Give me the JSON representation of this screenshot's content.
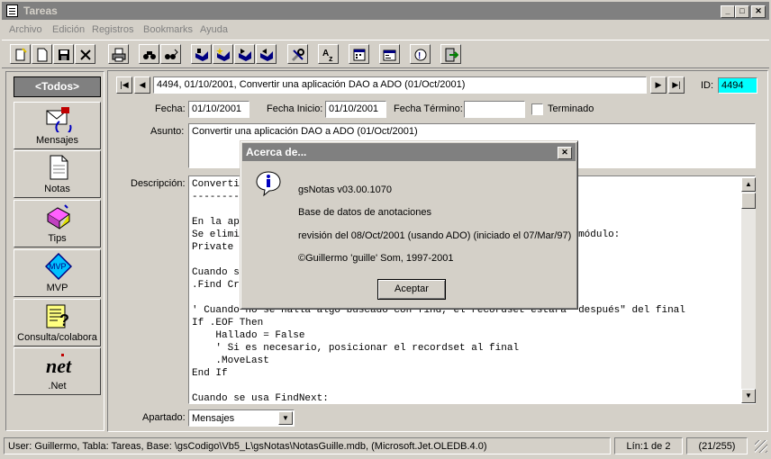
{
  "window": {
    "title": "Tareas"
  },
  "menu": [
    "Archivo",
    "Edición",
    "Registros",
    "Bookmarks",
    "Ayuda"
  ],
  "toolbar_icons": [
    "new-icon",
    "new-doc-icon",
    "save-icon",
    "delete-icon",
    "print-icon",
    "find-icon",
    "find-next-icon",
    "bookmark-icon",
    "bookmark-add-icon",
    "bookmark-next-icon",
    "bookmark-prev-icon",
    "tools-icon",
    "sort-az-icon",
    "calendar-icon",
    "properties-icon",
    "help-icon",
    "exit-icon"
  ],
  "sidebar": {
    "all_label": "<Todos>",
    "items": [
      {
        "label": "Mensajes",
        "icon": "mail-icon"
      },
      {
        "label": "Notas",
        "icon": "note-icon"
      },
      {
        "label": "Tips",
        "icon": "tips-icon"
      },
      {
        "label": "MVP",
        "icon": "mvp-icon"
      },
      {
        "label": "Consulta/colabora",
        "icon": "query-icon"
      },
      {
        "label": ".Net",
        "icon": "dotnet-icon"
      }
    ]
  },
  "record": {
    "selector": "4494, 01/10/2001, Convertir una aplicación DAO a ADO (01/Oct/2001)",
    "id_label": "ID:",
    "id_value": "4494",
    "fecha_label": "Fecha:",
    "fecha": "01/10/2001",
    "fecha_inicio_label": "Fecha Inicio:",
    "fecha_inicio": "01/10/2001",
    "fecha_termino_label": "Fecha Término:",
    "fecha_termino": "",
    "terminado_label": "Terminado",
    "asunto_label": "Asunto:",
    "asunto": "Convertir una aplicación DAO a ADO (01/Oct/2001)",
    "descripcion_label": "Descripción:",
    "descripcion": "Convertir\n---------\n\nEn la ap\nSe elimi                                                    l de módulo:\nPrivate \n\nCuando s                                                    :\n.Find Cr\n\n' Cuando no se halla algo buscado con find, el recordset estará \"después\" del final\nIf .EOF Then\n    Hallado = False\n    ' Si es necesario, posicionar el recordset al final\n    .MoveLast\nEnd If\n\nCuando se usa FindNext:",
    "apartado_label": "Apartado:",
    "apartado": "Mensajes"
  },
  "status": {
    "info": "User: Guillermo, Tabla: Tareas, Base: \\gsCodigo\\Vb5_L\\gsNotas\\NotasGuille.mdb, (Microsoft.Jet.OLEDB.4.0)",
    "line": "Lín:1 de 2",
    "count": "(21/255)"
  },
  "dialog": {
    "title": "Acerca de...",
    "line1": "gsNotas v03.00.1070",
    "line2": "Base de datos de anotaciones",
    "line3": "revisión del 08/Oct/2001 (usando ADO) (iniciado el 07/Mar/97)",
    "line4": "©Guillermo 'guille' Som, 1997-2001",
    "ok": "Aceptar"
  }
}
